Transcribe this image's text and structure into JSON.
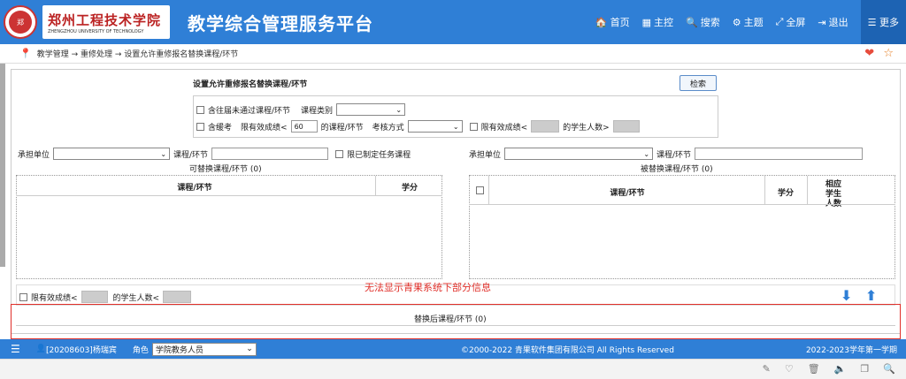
{
  "header": {
    "university_cn": "郑州工程技术学院",
    "university_en": "ZHENGZHOU UNIVERSITY OF TECHNOLOGY",
    "platform": "教学综合管理服务平台",
    "nav": [
      {
        "icon": "🏠",
        "label": "首页"
      },
      {
        "icon": "▦",
        "label": "主控"
      },
      {
        "icon": "🔍",
        "label": "搜索"
      },
      {
        "icon": "⚙",
        "label": "主题"
      },
      {
        "icon": "⤢",
        "label": "全屏"
      },
      {
        "icon": "⇥",
        "label": "退出"
      }
    ],
    "more_label": "更多"
  },
  "breadcrumb": "教学管理 → 重修处理 → 设置允许重修报名替换课程/环节",
  "form": {
    "title": "设置允许重修报名替换课程/环节",
    "search_label": "检索",
    "include_failed": "含往届未通过课程/环节",
    "course_type_label": "课程类别",
    "include_deferred": "含缓考",
    "limit_valid_label": "限有效成绩<",
    "limit_value": "60",
    "course_suffix": "的课程/环节",
    "exam_method_label": "考核方式",
    "limit_valid2": "限有效成绩<",
    "student_count_gt": "的学生人数>"
  },
  "left_panel": {
    "unit_label": "承担单位",
    "course_label": "课程/环节",
    "limit_task": "限已制定任务课程",
    "caption": "可替换课程/环节",
    "caption_count": "(0)",
    "col_course": "课程/环节",
    "col_credit": "学分"
  },
  "right_panel": {
    "unit_label": "承担单位",
    "course_label": "课程/环节",
    "caption": "被替换课程/环节",
    "caption_count": "(0)",
    "col_course": "课程/环节",
    "col_credit": "学分",
    "col_students": "相应学生人数"
  },
  "bottom": {
    "limit_valid": "限有效成绩<",
    "student_count_lt": "的学生人数<",
    "message": "无法显示青果系统下部分信息",
    "result_caption": "替换后课程/环节",
    "result_count": "(0)"
  },
  "footer": {
    "user": "[20208603]杨瑞宾",
    "role_label": "角色",
    "role_value": "学院教务人员",
    "copyright": "©2000-2022 青果软件集团有限公司 All Rights Reserved",
    "term": "2022-2023学年第一学期"
  }
}
